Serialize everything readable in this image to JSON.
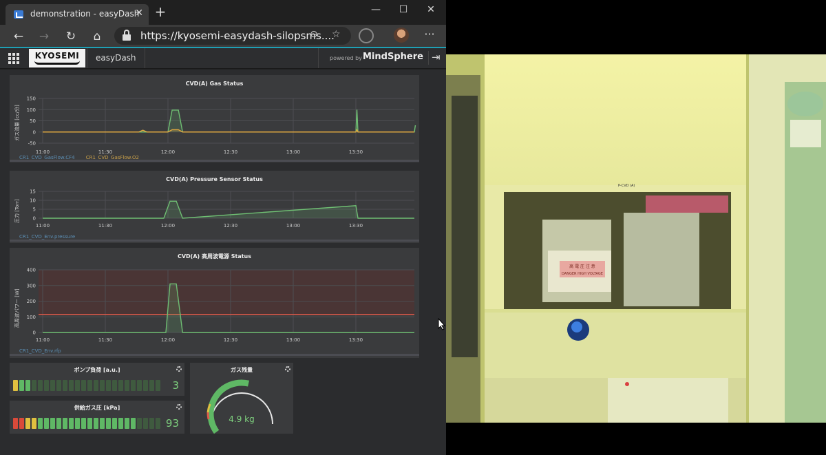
{
  "browser": {
    "tab_title": "demonstration - easyDash",
    "tab_close": "✕",
    "new_tab": "+",
    "minimize": "—",
    "maximize": "☐",
    "close": "✕",
    "url": "https://kyosemi-easydash-silopsms....",
    "back": "←",
    "forward": "→",
    "refresh": "↻",
    "home": "⌂",
    "zoom_icon": "⊖",
    "star_icon": "☆",
    "more": "···"
  },
  "app": {
    "logo_text": "KYOSEMI",
    "name": "easyDash",
    "powered_by": "powered by",
    "brand": "MindSphere",
    "logout": "⇥"
  },
  "colors": {
    "accent": "#1ea0b5",
    "line_green": "#6fbf73",
    "line_yellow": "#e0a840",
    "threshold_red": "#e05a4a"
  },
  "charts": {
    "gas": {
      "title": "CVD(A) Gas Status",
      "ylabel": "ガス流量 [cc/分]",
      "legend": [
        "CR1_CVD_GasFlow.CF4",
        "CR1_CVD_GasFlow.O2"
      ]
    },
    "pressure": {
      "title": "CVD(A) Pressure Sensor Status",
      "ylabel": "圧力 [Torr]",
      "legend": [
        "CR1_CVD_Env.pressure"
      ]
    },
    "power": {
      "title": "CVD(A) 高周波電源 Status",
      "ylabel": "高周波パワー [W]",
      "legend": [
        "CR1_CVD_Env.rfp"
      ]
    }
  },
  "chart_data": [
    {
      "type": "line",
      "title": "CVD(A) Gas Status",
      "ylabel": "ガス流量 [cc/分]",
      "ylim": [
        -50,
        150
      ],
      "yticks": [
        150,
        100,
        50,
        0,
        -50
      ],
      "xticks": [
        "11:00",
        "11:30",
        "12:00",
        "12:30",
        "13:00",
        "13:30"
      ],
      "grid": true,
      "series": [
        {
          "name": "CR1_CVD_GasFlow.CF4",
          "color": "#6fbf73",
          "points": [
            [
              0,
              0
            ],
            [
              60,
              0
            ],
            [
              62,
              98
            ],
            [
              65,
              98
            ],
            [
              67,
              0
            ],
            [
              150,
              0
            ],
            [
              150.5,
              100
            ],
            [
              151,
              0
            ],
            [
              178,
              0
            ],
            [
              178.5,
              30
            ]
          ]
        },
        {
          "name": "CR1_CVD_GasFlow.O2",
          "color": "#e0a840",
          "points": [
            [
              0,
              0
            ],
            [
              46,
              0
            ],
            [
              48,
              8
            ],
            [
              50,
              0
            ],
            [
              60,
              0
            ],
            [
              62,
              10
            ],
            [
              65,
              10
            ],
            [
              67,
              0
            ],
            [
              150,
              0
            ],
            [
              150.5,
              10
            ],
            [
              151,
              0
            ],
            [
              178,
              0
            ]
          ]
        }
      ]
    },
    {
      "type": "line",
      "title": "CVD(A) Pressure Sensor Status",
      "ylabel": "圧力 [Torr]",
      "ylim": [
        0,
        15
      ],
      "yticks": [
        15,
        10,
        5,
        0
      ],
      "xticks": [
        "11:00",
        "11:30",
        "12:00",
        "12:30",
        "13:00",
        "13:30"
      ],
      "grid": true,
      "series": [
        {
          "name": "CR1_CVD_Env.pressure",
          "color": "#6fbf73",
          "points": [
            [
              0,
              0
            ],
            [
              58,
              0
            ],
            [
              61,
              9.5
            ],
            [
              64,
              9.5
            ],
            [
              67,
              0
            ],
            [
              150,
              7
            ],
            [
              151,
              0
            ],
            [
              178,
              0
            ]
          ]
        }
      ]
    },
    {
      "type": "line",
      "title": "CVD(A) 高周波電源 Status",
      "ylabel": "高周波パワー [W]",
      "ylim": [
        0,
        400
      ],
      "yticks": [
        400,
        300,
        200,
        100,
        0
      ],
      "xticks": [
        "11:00",
        "11:30",
        "12:00",
        "12:30",
        "13:00",
        "13:30"
      ],
      "grid": true,
      "threshold": 115,
      "series": [
        {
          "name": "CR1_CVD_Env.rfp",
          "color": "#6fbf73",
          "points": [
            [
              0,
              0
            ],
            [
              59,
              0
            ],
            [
              61,
              310
            ],
            [
              64,
              310
            ],
            [
              67,
              0
            ],
            [
              178,
              0
            ]
          ]
        }
      ]
    }
  ],
  "gauges": {
    "pump": {
      "title": "ポンプ負荷 [a.u.]",
      "value": "3",
      "level": 3,
      "max": 24
    },
    "supply": {
      "title": "供給ガス圧 [kPa]",
      "value": "93",
      "level": 20,
      "max": 24
    },
    "gas_remaining": {
      "title": "ガス残量",
      "value": "4.9 kg",
      "fraction": 0.49
    }
  },
  "camera": {
    "panel_label": "P-CVD (A)",
    "warning_label_1": "高 電 圧 注 意",
    "warning_label_2": "DANGER HIGH VOLTAGE"
  }
}
